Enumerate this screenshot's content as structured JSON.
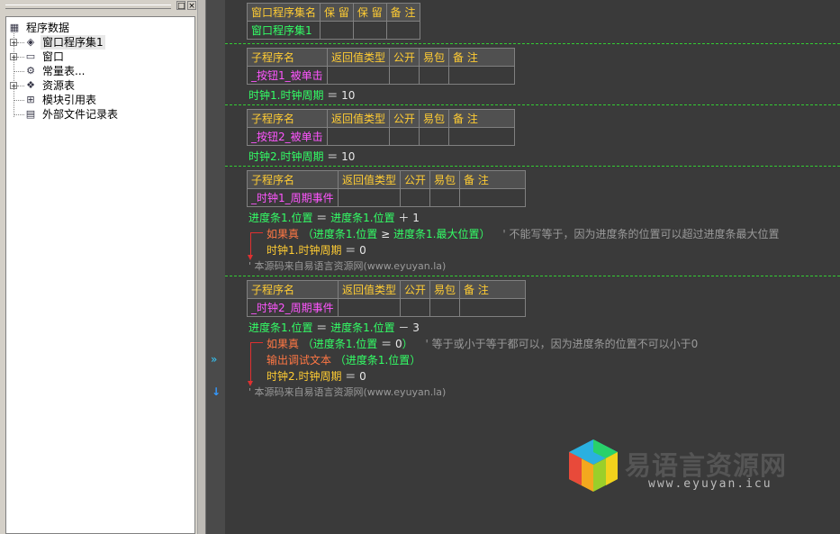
{
  "tree": {
    "root": "程序数据",
    "items": [
      {
        "label": "窗口程序集1",
        "icon": "layers-icon",
        "expandable": true
      },
      {
        "label": "窗口",
        "icon": "window-icon",
        "expandable": true
      },
      {
        "label": "常量表...",
        "icon": "constant-table-icon",
        "expandable": false
      },
      {
        "label": "资源表",
        "icon": "resource-icon",
        "expandable": true
      },
      {
        "label": "模块引用表",
        "icon": "module-ref-icon",
        "expandable": false
      },
      {
        "label": "外部文件记录表",
        "icon": "file-record-icon",
        "expandable": false
      }
    ]
  },
  "panel": {
    "pin_glyph": "□",
    "close_glyph": "×"
  },
  "assembly_table": {
    "headers": [
      "窗口程序集名",
      "保 留",
      "保 留",
      "备 注"
    ],
    "name": "窗口程序集1"
  },
  "sub_headers": [
    "子程序名",
    "返回值类型",
    "公开",
    "易包",
    "备 注"
  ],
  "subs": [
    {
      "name": "_按钮1_被单击",
      "code": {
        "obj": "时钟1.时钟周期",
        "op": "＝",
        "val": "10"
      }
    },
    {
      "name": "_按钮2_被单击",
      "code": {
        "obj": "时钟2.时钟周期",
        "op": "＝",
        "val": "10"
      }
    },
    {
      "name": "_时钟1_周期事件",
      "line1": {
        "lhs": "进度条1.位置",
        "eq": "＝",
        "rhs": "进度条1.位置",
        "op": "＋",
        "val": "1"
      },
      "if_kw": "如果真",
      "if_open": "（",
      "if_left": "进度条1.位置",
      "if_cmp": "≥",
      "if_right": "进度条1.最大位置",
      "if_close": "）",
      "if_comment": "' 不能写等于，因为进度条的位置可以超过进度条最大位置",
      "body": {
        "obj": "时钟1.时钟周期",
        "op": "＝",
        "val": "0"
      },
      "footer_comment": "' 本源码来自易语言资源网(www.eyuyan.la)"
    },
    {
      "name": "_时钟2_周期事件",
      "line1": {
        "lhs": "进度条1.位置",
        "eq": "＝",
        "rhs": "进度条1.位置",
        "op": "－",
        "val": "3"
      },
      "if_kw": "如果真",
      "if_open": "（",
      "if_left": "进度条1.位置",
      "if_cmp": "＝",
      "if_right": "0",
      "if_close": "）",
      "if_comment": "' 等于或小于等于都可以，因为进度条的位置不可以小于0",
      "debug_cmd": "输出调试文本",
      "debug_arg_open": "（",
      "debug_arg": "进度条1.位置",
      "debug_arg_close": "）",
      "body": {
        "obj": "时钟2.时钟周期",
        "op": "＝",
        "val": "0"
      },
      "footer_comment": "' 本源码来自易语言资源网(www.eyuyan.la)"
    }
  ],
  "gutter": {
    "breakpoint_glyph": "»",
    "cursor_glyph": "↓"
  },
  "watermark": {
    "title": "易语言资源网",
    "url": "www.eyuyan.icu"
  },
  "colors": {
    "accent_green": "#33ff66",
    "header_yellow": "#ffcc33",
    "sub_name_magenta": "#ff55ff",
    "keyword_orange": "#ff7744",
    "comment_gray": "#9a9a9a",
    "separator_green": "#33cc33"
  }
}
